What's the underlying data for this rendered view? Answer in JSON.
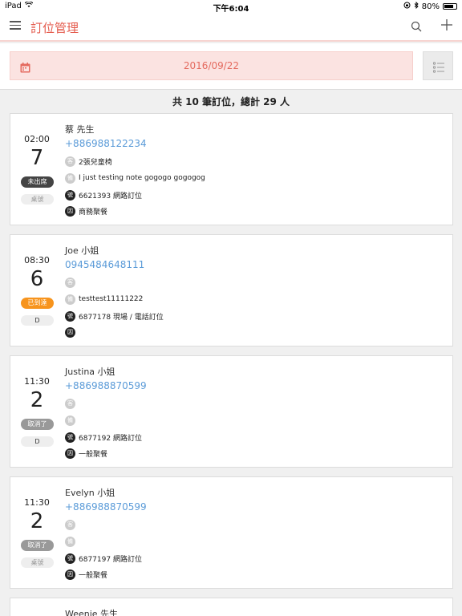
{
  "statusbar": {
    "device": "iPad",
    "time": "下午6:04",
    "battery": "80%",
    "battery_level": 0.8
  },
  "header": {
    "title": "訂位管理"
  },
  "toolbar": {
    "date": "2016/09/22"
  },
  "summary": "共 10 筆訂位，總計 29 人",
  "badges": {
    "guest": "客",
    "note": "備",
    "number": "號",
    "reason": "因"
  },
  "bookings": [
    {
      "time": "02:00",
      "party_size": "7",
      "status": "未出席",
      "status_color": "#444444",
      "table": "桌號",
      "name": "蔡 先生",
      "phone": "+886988122234",
      "guest_note": "2張兒童椅",
      "note": "I just testing note gogogo gogogog",
      "number": "6621393 網路訂位",
      "reason": "商務聚餐"
    },
    {
      "time": "08:30",
      "party_size": "6",
      "status": "已到達",
      "status_color": "#f7941d",
      "table": "D",
      "name": "Joe 小姐",
      "phone": "0945484648111",
      "guest_note": "",
      "note": "testtest11111222",
      "number": "6877178 現場 / 電話訂位",
      "reason": ""
    },
    {
      "time": "11:30",
      "party_size": "2",
      "status": "取消了",
      "status_color": "#999999",
      "table": "D",
      "name": "Justina 小姐",
      "phone": "+886988870599",
      "guest_note": "",
      "note": "",
      "number": "6877192 網路訂位",
      "reason": "一般聚餐"
    },
    {
      "time": "11:30",
      "party_size": "2",
      "status": "取消了",
      "status_color": "#999999",
      "table": "桌號",
      "name": "Evelyn 小姐",
      "phone": "+886988870599",
      "guest_note": "",
      "note": "",
      "number": "6877197 網路訂位",
      "reason": "一般聚餐"
    },
    {
      "name": "Weenie 先生"
    }
  ]
}
